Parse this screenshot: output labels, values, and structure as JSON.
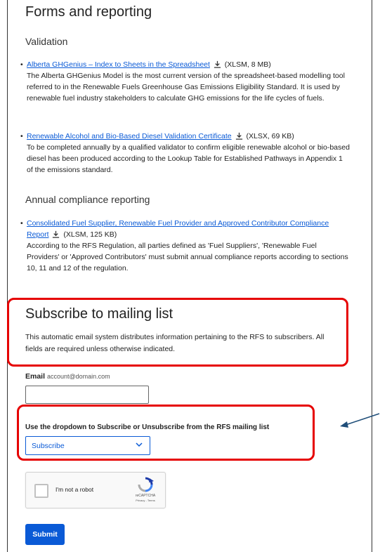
{
  "forms": {
    "title": "Forms and reporting",
    "validation_heading": "Validation",
    "items": [
      {
        "link": "Alberta GHGenius – Index to Sheets in the Spreadsheet",
        "meta": "(XLSM, 8 MB)",
        "desc": "The Alberta GHGenius Model is the most current version of the spreadsheet-based modelling tool referred to in the Renewable Fuels Greenhouse Gas Emissions Eligibility Standard. It is used by renewable fuel industry stakeholders to calculate GHG emissions for the life cycles of fuels."
      },
      {
        "link": "Renewable Alcohol and Bio-Based Diesel Validation Certificate",
        "meta": "(XLSX, 69 KB)",
        "desc": "To be completed annually by a qualified validator to confirm eligible renewable alcohol or bio-based diesel has been produced according to the Lookup Table for Established Pathways in Appendix 1 of the emissions standard."
      }
    ],
    "annual_heading": "Annual compliance reporting",
    "annual_items": [
      {
        "link": "Consolidated Fuel Supplier, Renewable Fuel Provider and Approved Contributor Compliance Report",
        "meta": "(XLSM, 125 KB)",
        "desc": "According to the RFS Regulation, all parties defined as 'Fuel Suppliers', 'Renewable Fuel Providers' or 'Approved Contributors' must submit annual compliance reports according to sections 10, 11 and 12 of the regulation."
      }
    ]
  },
  "subscribe": {
    "title": "Subscribe to mailing list",
    "intro": "This automatic email system distributes information pertaining to the RFS to subscribers. All fields are required unless otherwise indicated.",
    "email_label": "Email",
    "email_hint": "account@domain.com",
    "email_value": "",
    "dropdown_label": "Use the dropdown to Subscribe or Unsubscribe from the RFS mailing list",
    "dropdown_value": "Subscribe",
    "captcha_text": "I'm not a robot",
    "captcha_brand": "reCAPTCHA",
    "captcha_links": "Privacy - Terms",
    "submit_label": "Submit"
  },
  "colors": {
    "link": "#0a5ad6",
    "highlight": "#e60000",
    "arrow": "#1f4e79"
  }
}
